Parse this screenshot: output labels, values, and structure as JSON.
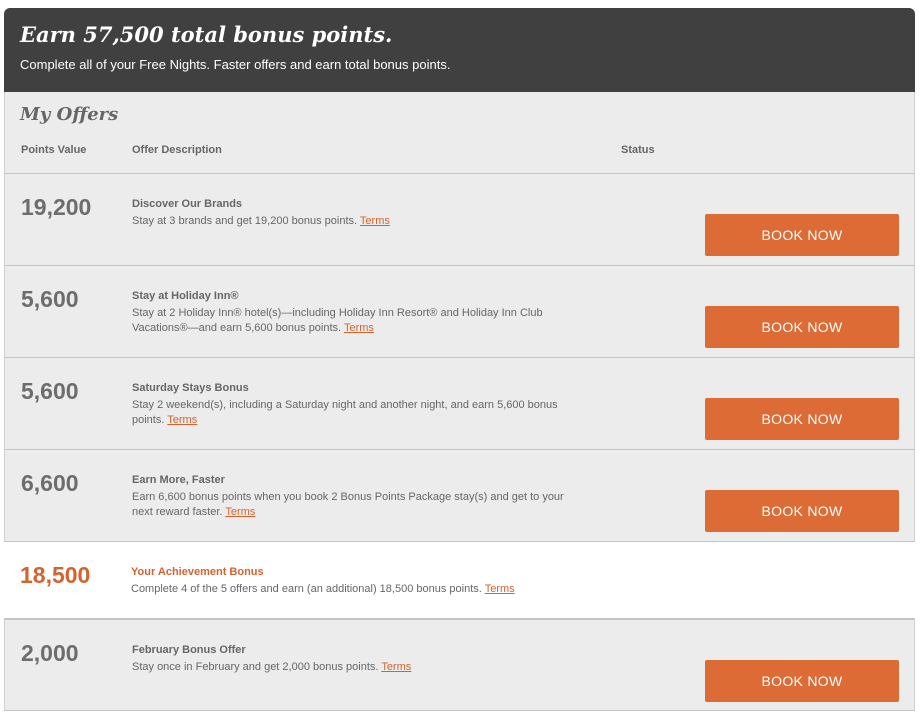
{
  "banner": {
    "title": "Earn 57,500 total bonus points.",
    "subtitle": "Complete all of your Free Nights. Faster offers and earn total bonus points."
  },
  "offers_section": {
    "title": "My Offers",
    "col_points": "Points Value",
    "col_description": "Offer Description",
    "col_status": "Status"
  },
  "terms_label": "Terms",
  "book_label": "BOOK NOW",
  "offers": [
    {
      "points": "19,200",
      "title": "Discover Our Brands",
      "description": "Stay at 3 brands and get 19,200 bonus points."
    },
    {
      "points": "5,600",
      "title": "Stay at Holiday Inn®",
      "description": "Stay at 2 Holiday Inn® hotel(s)—including Holiday Inn Resort® and Holiday Inn Club Vacations®—and earn 5,600 bonus points."
    },
    {
      "points": "5,600",
      "title": "Saturday Stays Bonus",
      "description": "Stay 2 weekend(s), including a Saturday night and another night, and earn 5,600 bonus points."
    },
    {
      "points": "6,600",
      "title": "Earn More, Faster",
      "description": "Earn 6,600 bonus points when you book 2 Bonus Points Package stay(s) and get to your next reward faster."
    }
  ],
  "achievement": {
    "points": "18,500",
    "title": "Your Achievement Bonus",
    "description": "Complete 4 of the 5 offers and earn (an additional) 18,500 bonus points."
  },
  "february": {
    "points": "2,000",
    "title": "February Bonus Offer",
    "description": "Stay once in February and get 2,000 bonus points."
  },
  "colors": {
    "banner_bg": "#404040",
    "accent_orange": "#dd6b36",
    "row_bg": "#ececec"
  }
}
